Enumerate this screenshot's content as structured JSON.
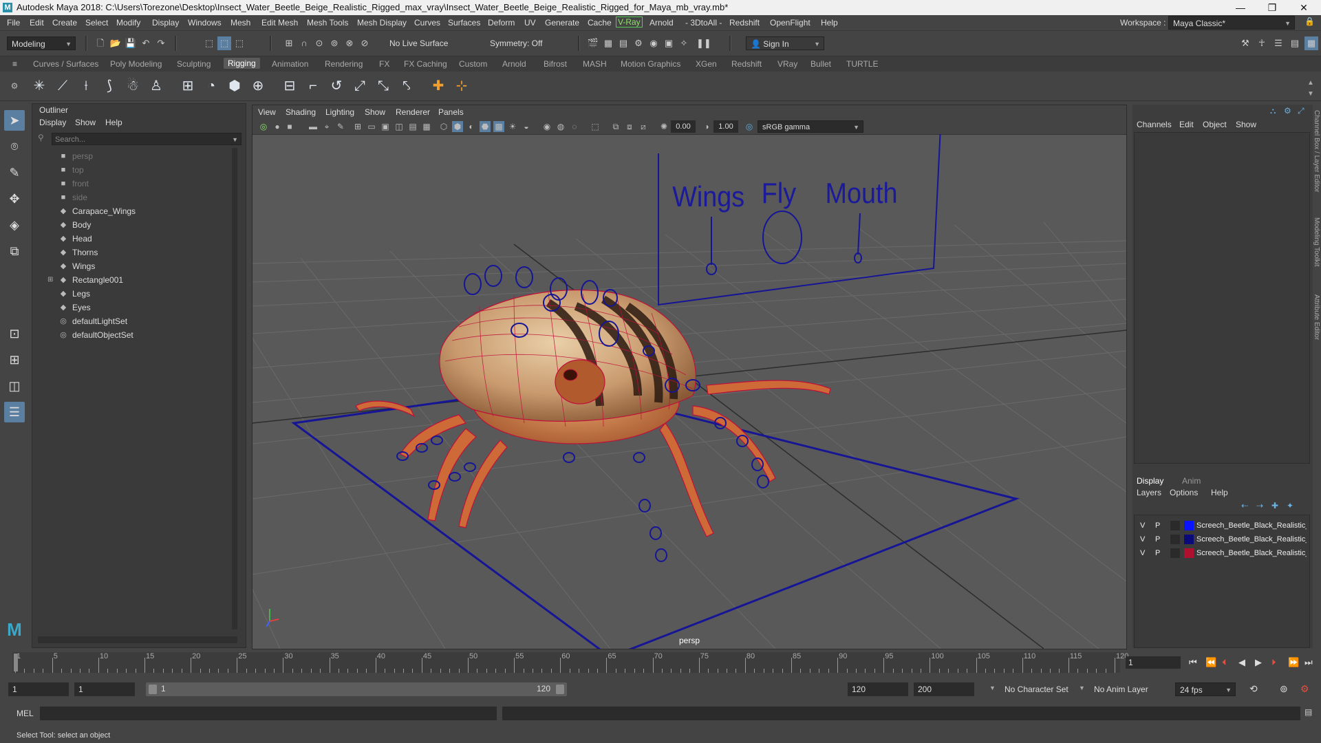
{
  "titlebar": {
    "title": "Autodesk Maya 2018: C:\\Users\\Torezone\\Desktop\\Insect_Water_Beetle_Beige_Realistic_Rigged_max_vray\\Insect_Water_Beetle_Beige_Realistic_Rigged_for_Maya_mb_vray.mb*",
    "logo": "M",
    "minimize": "—",
    "restore": "❐",
    "close": "✕"
  },
  "menubar": {
    "items": [
      "File",
      "Edit",
      "Create",
      "Select",
      "Modify",
      "Display",
      "Windows",
      "Mesh",
      "Edit Mesh",
      "Mesh Tools",
      "Mesh Display",
      "Curves",
      "Surfaces",
      "Deform",
      "UV",
      "Generate",
      "Cache",
      "V-Ray",
      "Arnold",
      "- 3DtoAll -",
      "Redshift",
      "OpenFlight",
      "Help"
    ],
    "workspace_label": "Workspace :",
    "workspace_value": "Maya Classic*"
  },
  "statusline": {
    "mode": "Modeling",
    "live_surface": "No Live Surface",
    "symmetry": "Symmetry: Off",
    "sign_in": "Sign In"
  },
  "shelf": {
    "tabs": [
      "Curves / Surfaces",
      "Poly Modeling",
      "Sculpting",
      "Rigging",
      "Animation",
      "Rendering",
      "FX",
      "FX Caching",
      "Custom",
      "Arnold",
      "Bifrost",
      "MASH",
      "Motion Graphics",
      "XGen",
      "Redshift",
      "VRay",
      "Bullet",
      "TURTLE"
    ],
    "active_tab": "Rigging"
  },
  "outliner": {
    "title": "Outliner",
    "menu": [
      "Display",
      "Show",
      "Help"
    ],
    "search_placeholder": "Search...",
    "items": [
      {
        "label": "persp",
        "type": "camera",
        "dim": true
      },
      {
        "label": "top",
        "type": "camera",
        "dim": true
      },
      {
        "label": "front",
        "type": "camera",
        "dim": true
      },
      {
        "label": "side",
        "type": "camera",
        "dim": true
      },
      {
        "label": "Carapace_Wings",
        "type": "mesh",
        "dim": false
      },
      {
        "label": "Body",
        "type": "mesh",
        "dim": false
      },
      {
        "label": "Head",
        "type": "mesh",
        "dim": false
      },
      {
        "label": "Thorns",
        "type": "mesh",
        "dim": false
      },
      {
        "label": "Wings",
        "type": "mesh",
        "dim": false
      },
      {
        "label": "Rectangle001",
        "type": "mesh",
        "dim": false,
        "expandable": true
      },
      {
        "label": "Legs",
        "type": "mesh",
        "dim": false
      },
      {
        "label": "Eyes",
        "type": "mesh",
        "dim": false
      },
      {
        "label": "defaultLightSet",
        "type": "set",
        "dim": false
      },
      {
        "label": "defaultObjectSet",
        "type": "set",
        "dim": false
      }
    ]
  },
  "viewport": {
    "menu": [
      "View",
      "Shading",
      "Lighting",
      "Show",
      "Renderer",
      "Panels"
    ],
    "exposure": "0.00",
    "gamma": "1.00",
    "color_space": "sRGB gamma",
    "camera_label": "persp",
    "control_board_labels": [
      "Wings",
      "Fly",
      "Mouth"
    ]
  },
  "rightpanel": {
    "channel_menu": [
      "Channels",
      "Edit",
      "Object",
      "Show"
    ],
    "layer_tabs": [
      "Display",
      "Anim"
    ],
    "layer_menu": [
      "Layers",
      "Options",
      "Help"
    ],
    "layers": [
      {
        "v": "V",
        "p": "P",
        "name": "Screech_Beetle_Black_Realistic_",
        "color": "#0a14ff"
      },
      {
        "v": "V",
        "p": "P",
        "name": "Screech_Beetle_Black_Realistic_",
        "color": "#0a0a7a"
      },
      {
        "v": "V",
        "p": "P",
        "name": "Screech_Beetle_Black_Realistic_",
        "color": "#b01030"
      }
    ],
    "side_tabs": [
      "Channel Box / Layer Editor",
      "Modeling Toolkit",
      "Attribute Editor"
    ]
  },
  "timeslider": {
    "labels": [
      "1",
      "5",
      "10",
      "15",
      "20",
      "25",
      "30",
      "35",
      "40",
      "45",
      "50",
      "55",
      "60",
      "65",
      "70",
      "75",
      "80",
      "85",
      "90",
      "95",
      "100",
      "105",
      "110",
      "115",
      "120"
    ],
    "current_frame": "1"
  },
  "rangeslider": {
    "start": "1",
    "playback_start": "1",
    "range_start_label": "1",
    "range_end_label": "120",
    "playback_end": "120",
    "end": "200",
    "character_set": "No Character Set",
    "anim_layer": "No Anim Layer",
    "fps": "24 fps"
  },
  "cmdline": {
    "label": "MEL"
  },
  "helpline": {
    "text": "Select Tool: select an object"
  },
  "colors": {
    "accent": "#5a7fa0",
    "rig_blue": "#1a1a9a",
    "wire_red": "#c0103a"
  }
}
